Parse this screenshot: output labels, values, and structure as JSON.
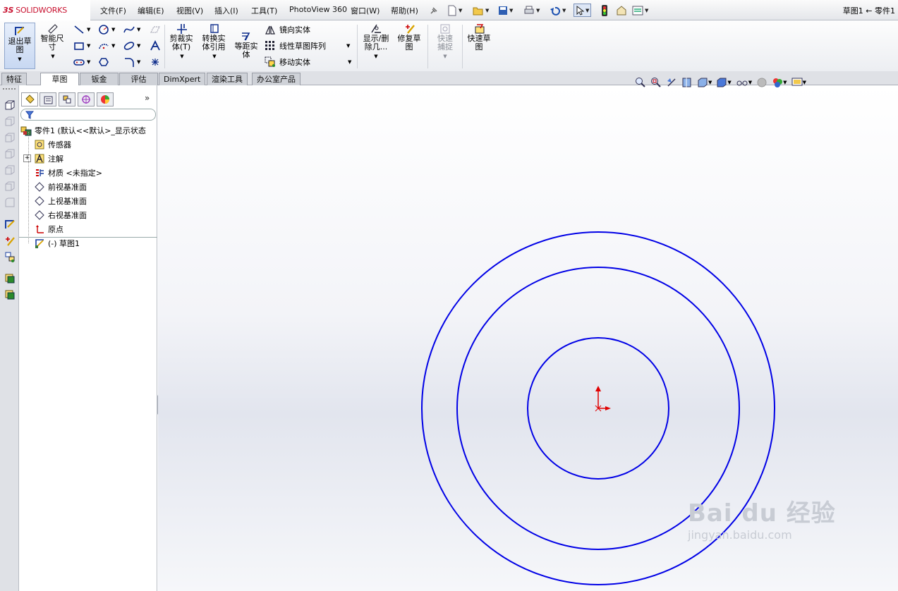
{
  "app": {
    "logo_ds": "3S",
    "logo_name": "SOLIDWORKS",
    "title": "草图1 ← 零件1"
  },
  "menu": {
    "file": "文件(F)",
    "edit": "编辑(E)",
    "view": "视图(V)",
    "insert": "插入(I)",
    "tools": "工具(T)",
    "photoview": "PhotoView 360",
    "window": "窗口(W)",
    "help": "帮助(H)"
  },
  "cmd": {
    "exit_sketch": "退出草图",
    "smart_dim": "智能尺寸",
    "trim": "剪裁实体(T)",
    "convert": "转换实体引用",
    "offset": "等距实体",
    "mirror": "镜向实体",
    "linear_pattern": "线性草图阵列",
    "move": "移动实体",
    "display_delete": "显示/删除几...",
    "repair": "修复草图",
    "quick_snap": "快速捕捉",
    "rapid_sketch": "快速草图"
  },
  "tabs": {
    "features": "特征",
    "sketch": "草图",
    "sheet_metal": "钣金",
    "evaluate": "评估",
    "dimxpert": "DimXpert",
    "render": "渲染工具",
    "office": "办公室产品"
  },
  "tree": {
    "root": "零件1 (默认<<默认>_显示状态",
    "sensors": "传感器",
    "annotations": "注解",
    "material": "材质 <未指定>",
    "front_plane": "前视基准面",
    "top_plane": "上视基准面",
    "right_plane": "右视基准面",
    "origin": "原点",
    "sketch1": "(-) 草图1"
  },
  "watermark": {
    "brand": "Bai du 经验",
    "url": "jingyan.baidu.com"
  },
  "colors": {
    "sketch_line": "#0000e6",
    "origin": "#e00000",
    "brand_red": "#c8102e"
  }
}
